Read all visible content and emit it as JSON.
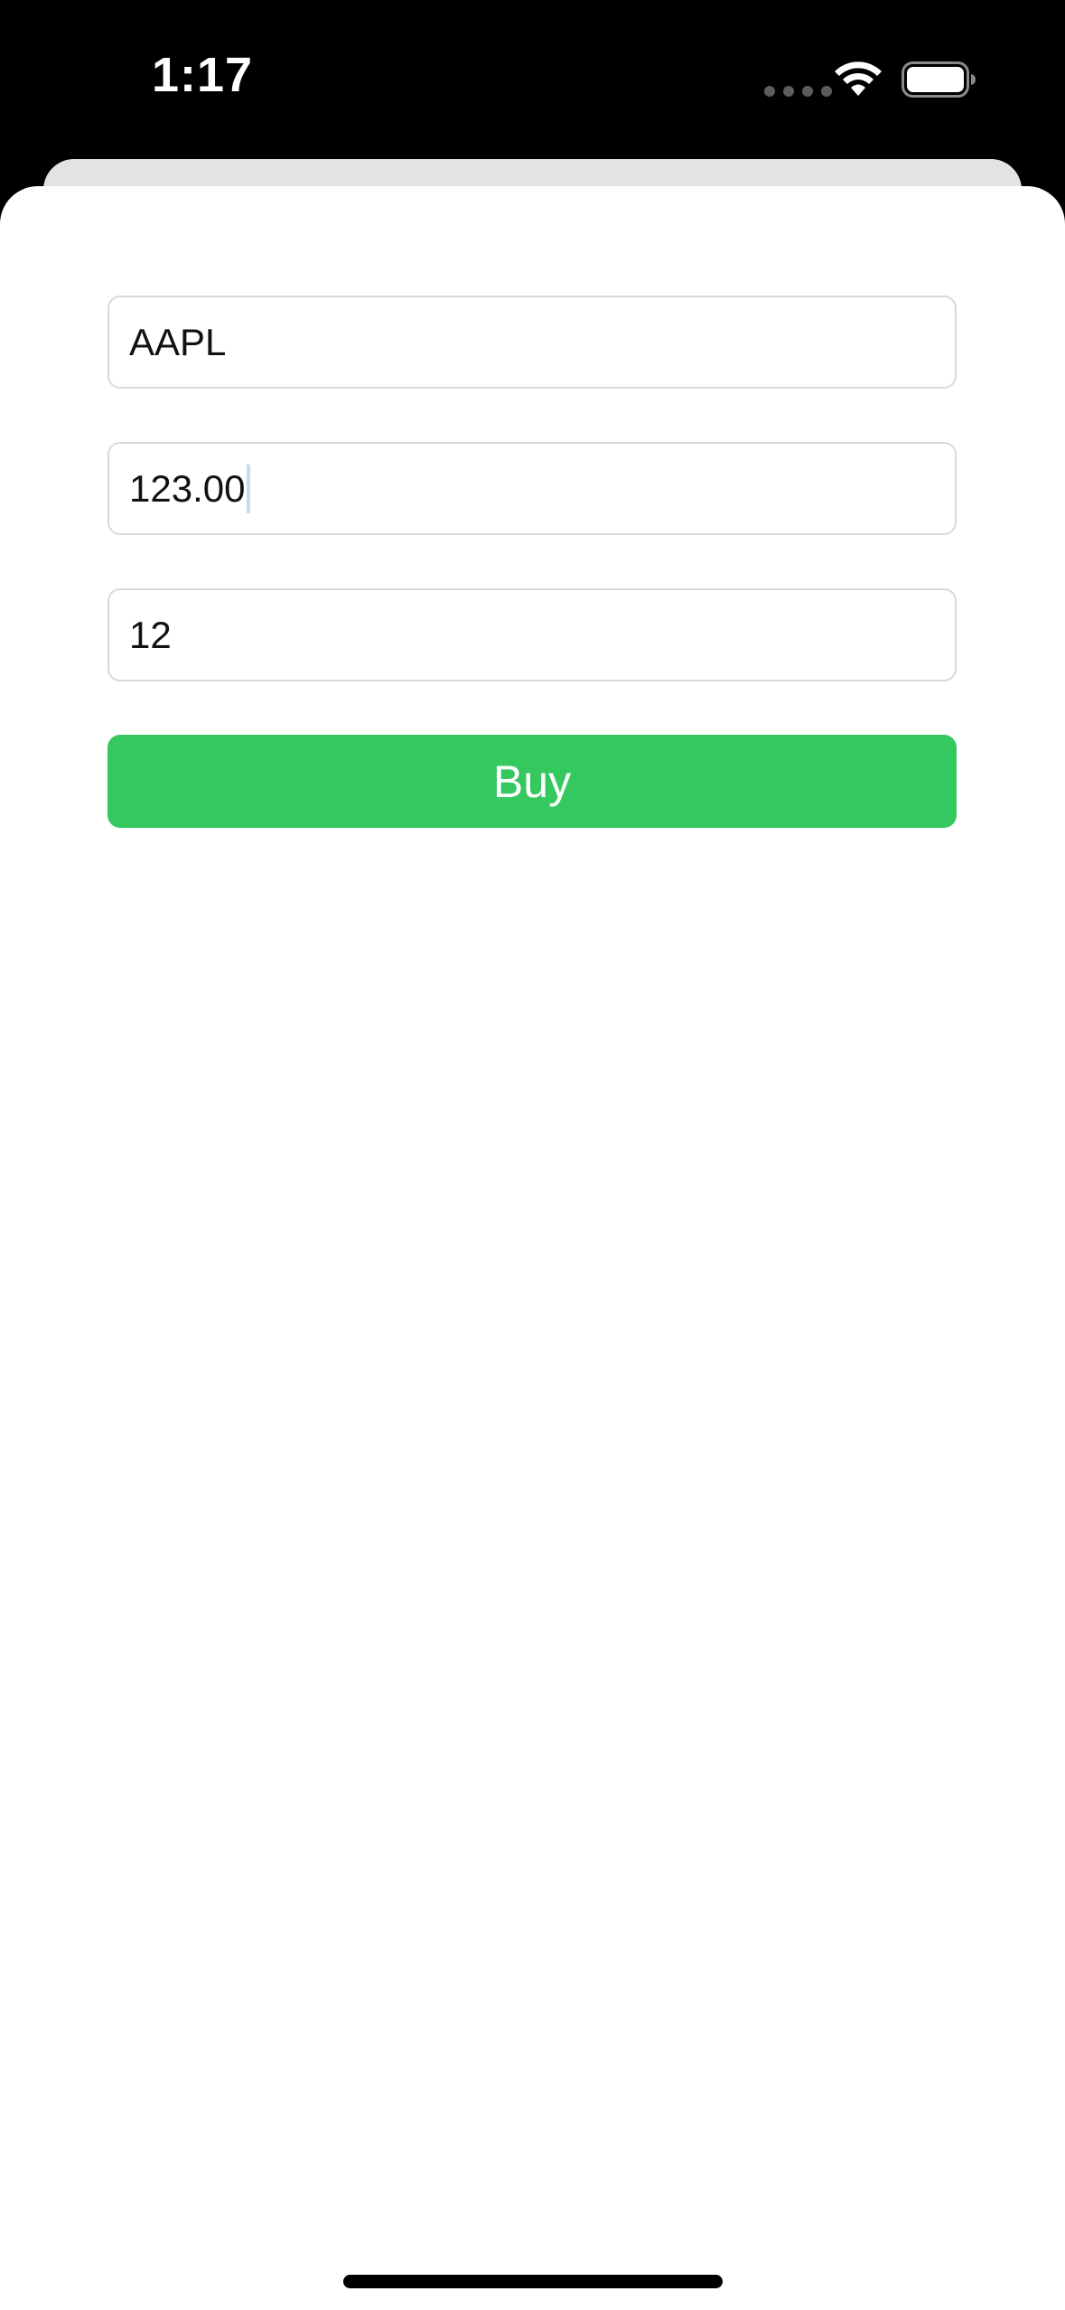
{
  "status_bar": {
    "time": "1:17",
    "icons": [
      "signal-dots-icon",
      "wifi-icon",
      "battery-icon"
    ]
  },
  "form": {
    "symbol_field": {
      "value": "AAPL"
    },
    "price_field": {
      "value": "123.00"
    },
    "quantity_field": {
      "value": "12"
    },
    "buy_button": {
      "label": "Buy"
    }
  },
  "colors": {
    "buy_button": "#35c85f",
    "sheet_background": "#ffffff",
    "status_bar_background": "#000000"
  }
}
